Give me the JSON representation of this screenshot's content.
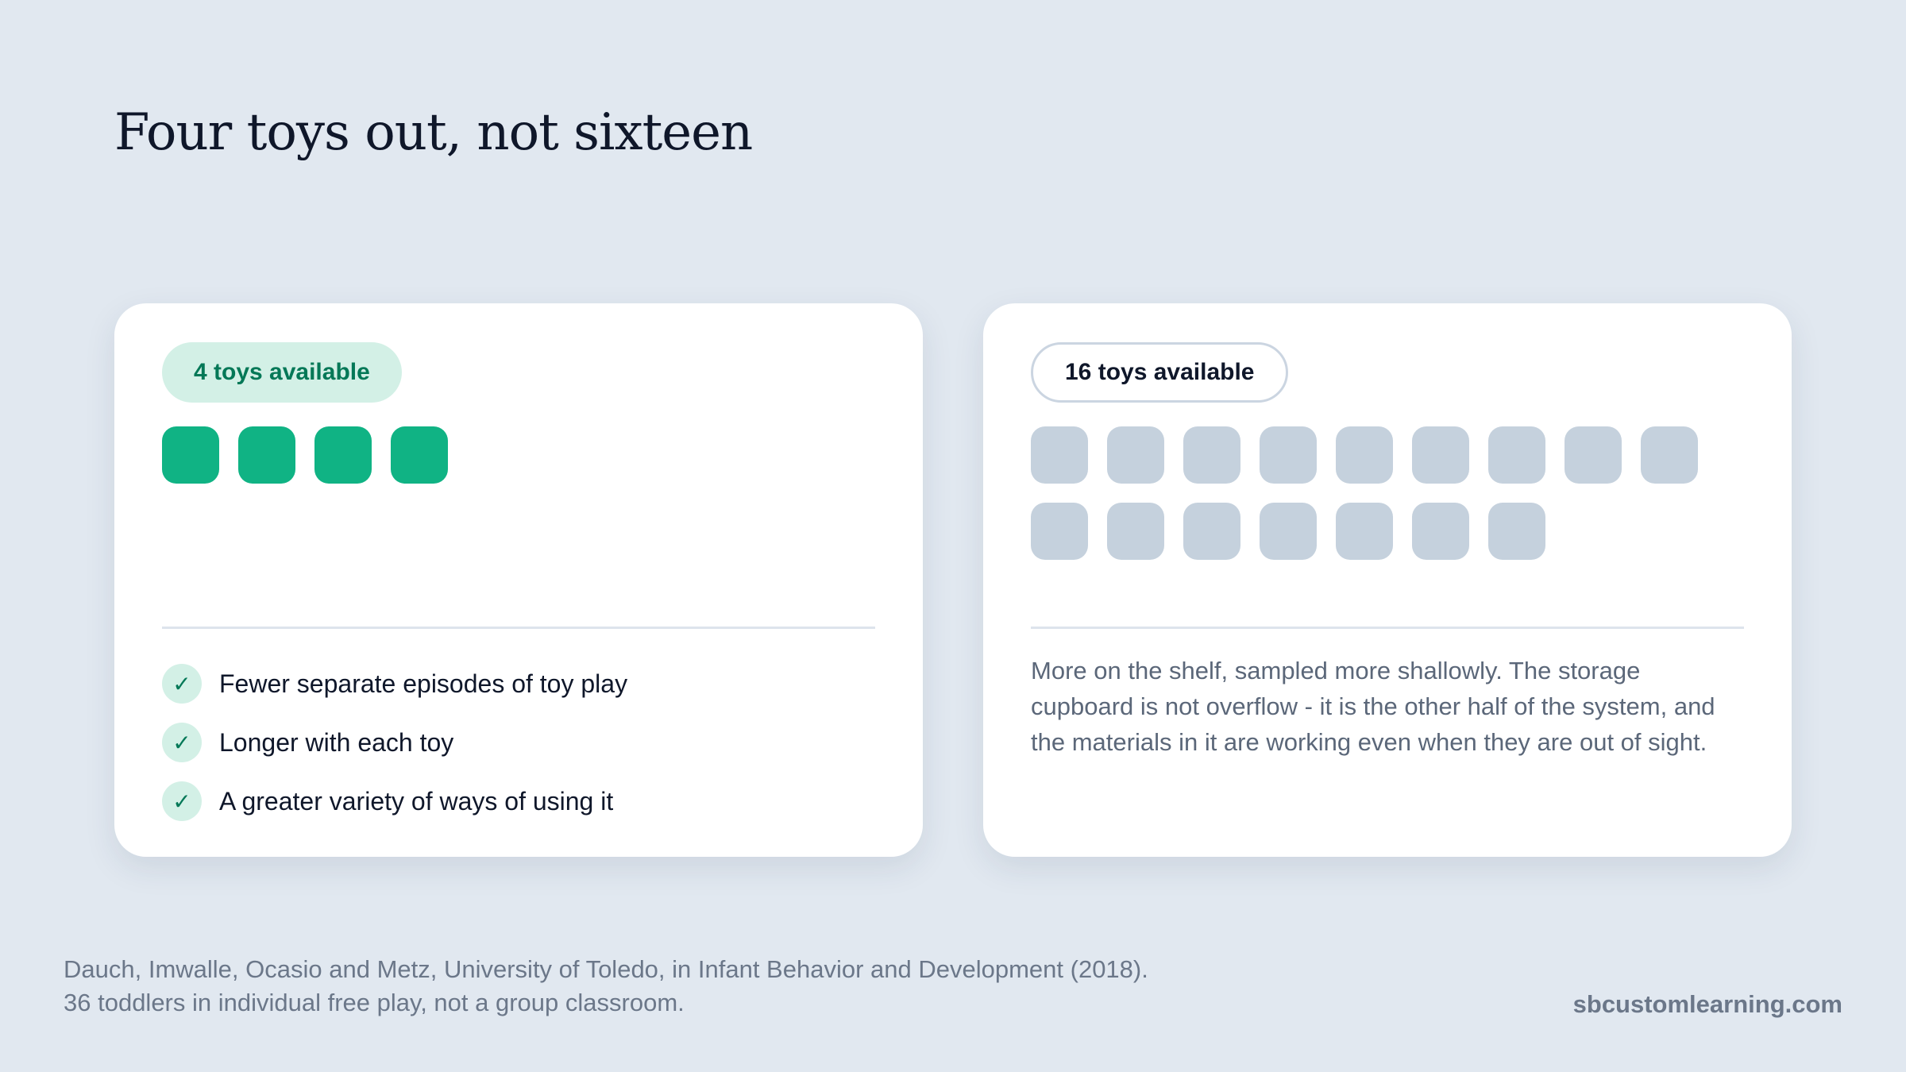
{
  "title": "Four toys out, not sixteen",
  "left_card": {
    "badge": "4 toys available",
    "toy_count": 4,
    "toy_color": "#10b384",
    "benefits": [
      {
        "icon": "check-icon",
        "symbol": "✓",
        "text": "Fewer separate episodes of toy play"
      },
      {
        "icon": "check-icon",
        "symbol": "✓",
        "text": "Longer with each toy"
      },
      {
        "icon": "check-icon",
        "symbol": "✓",
        "text": "A greater variety of ways of using it"
      }
    ]
  },
  "right_card": {
    "badge": "16 toys available",
    "toy_count": 16,
    "toy_color": "#c5d1dd",
    "description": "More on the shelf, sampled more shallowly. The storage cupboard is not overflow - it is the other half of the system, and the materials in it are working even when they are out of sight."
  },
  "footer": {
    "citation": "Dauch, Imwalle, Ocasio and Metz, University of Toledo, in Infant Behavior and Development (2018). 36 toddlers in individual free play, not a group classroom.",
    "site": "sbcustomlearning.com"
  },
  "colors": {
    "background": "#e1e8f0",
    "accent_green": "#047857",
    "accent_green_light": "#d3f0e6"
  }
}
